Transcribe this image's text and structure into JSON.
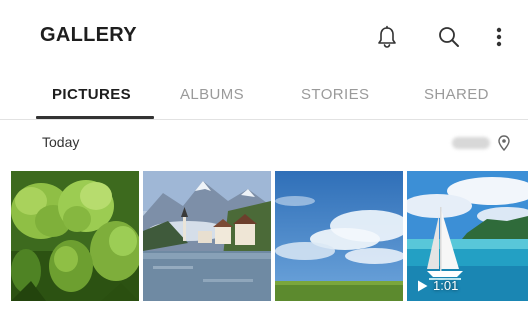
{
  "app_bar": {
    "title": "GALLERY",
    "icons": [
      "bell-icon",
      "search-icon",
      "more-vert-icon"
    ]
  },
  "tabs": [
    {
      "label": "PICTURES",
      "active": true
    },
    {
      "label": "ALBUMS",
      "active": false
    },
    {
      "label": "STORIES",
      "active": false
    },
    {
      "label": "SHARED",
      "active": false
    }
  ],
  "section": {
    "date": "Today",
    "location_icon": "map-pin-icon"
  },
  "thumbnails": [
    {
      "subject": "green hop cones"
    },
    {
      "subject": "lakeside alpine village"
    },
    {
      "subject": "blue sky with clouds over field"
    },
    {
      "subject": "sailboat on turquoise sea",
      "video_duration": "1:01",
      "icon": "play-icon"
    }
  ],
  "colors": {
    "title_text": "#1e1e1e",
    "inactive_tab": "#9a9a9a",
    "indicator": "#333333",
    "background": "#ffffff"
  }
}
